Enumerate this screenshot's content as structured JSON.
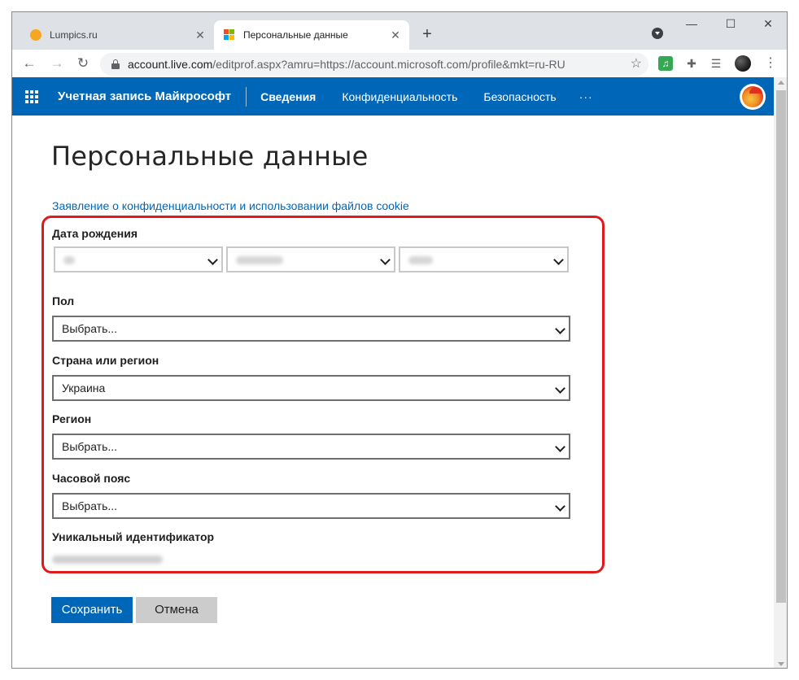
{
  "browser": {
    "tabs": [
      {
        "title": "Lumpics.ru",
        "active": false
      },
      {
        "title": "Персональные данные",
        "active": true
      }
    ],
    "new_tab": "+",
    "url_host": "account.live.com",
    "url_rest": "/editprof.aspx?amru=https://account.microsoft.com/profile&mkt=ru-RU",
    "window_controls": [
      "—",
      "☐",
      "✕"
    ]
  },
  "ms_header": {
    "brand": "Учетная запись Майкрософт",
    "nav": [
      "Сведения",
      "Конфиденциальность",
      "Безопасность"
    ],
    "more": "···"
  },
  "page": {
    "title": "Персональные данные",
    "privacy_link": "Заявление о конфиденциальности и использовании файлов cookie"
  },
  "form": {
    "birthdate_label": "Дата рождения",
    "gender_label": "Пол",
    "gender_value": "Выбрать...",
    "country_label": "Страна или регион",
    "country_value": "Украина",
    "region_label": "Регион",
    "region_value": "Выбрать...",
    "timezone_label": "Часовой пояс",
    "timezone_value": "Выбрать...",
    "uid_label": "Уникальный идентификатор"
  },
  "buttons": {
    "save": "Сохранить",
    "cancel": "Отмена"
  },
  "colors": {
    "ms_blue": "#0067b8",
    "highlight_red": "#e01a1a"
  }
}
